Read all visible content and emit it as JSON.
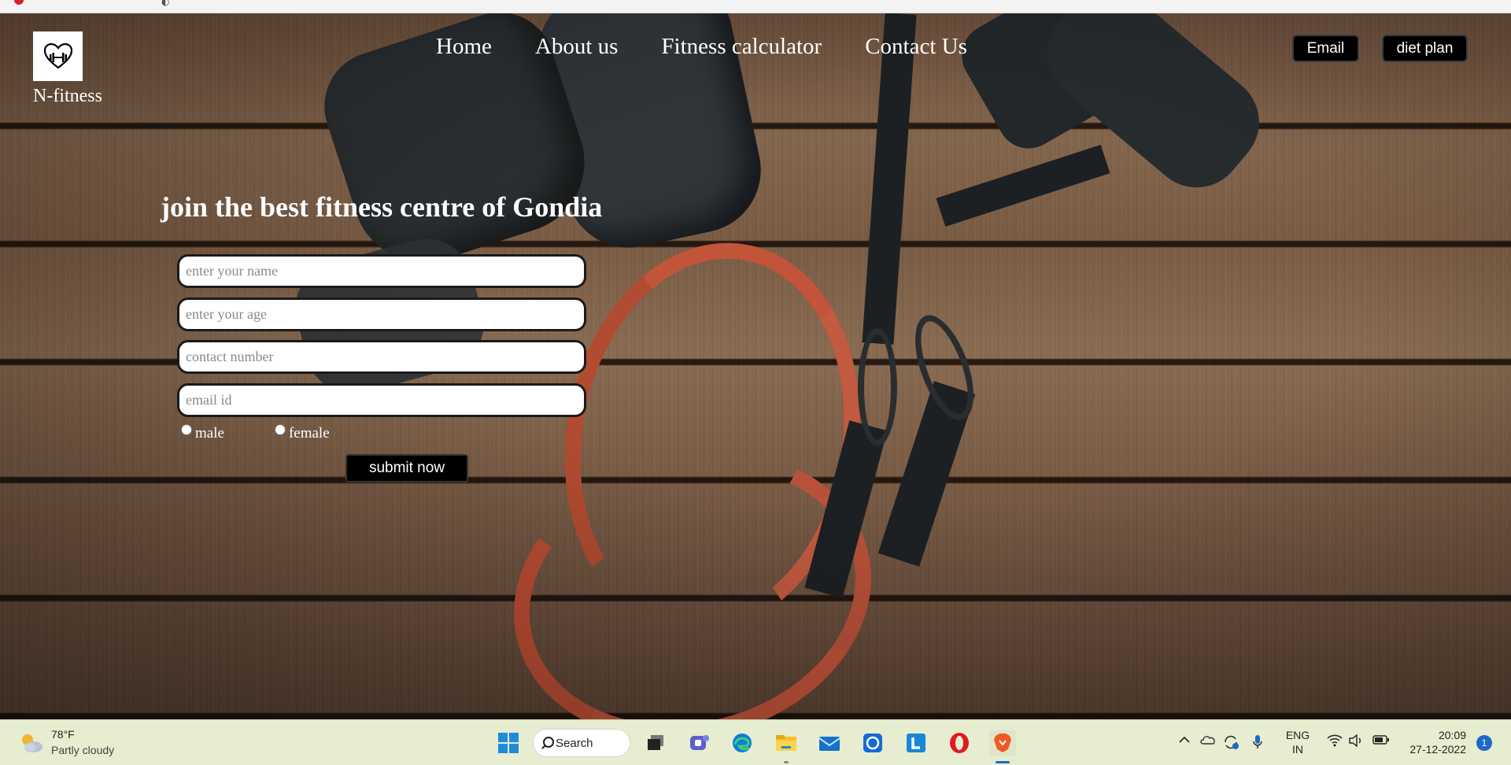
{
  "brand": {
    "name": "N-fitness"
  },
  "nav": {
    "items": [
      {
        "label": "Home"
      },
      {
        "label": "About us"
      },
      {
        "label": "Fitness calculator"
      },
      {
        "label": "Contact Us"
      }
    ]
  },
  "header_buttons": {
    "email": "Email",
    "diet_plan": "diet plan"
  },
  "hero": {
    "headline": "join the best fitness centre of Gondia"
  },
  "form": {
    "name_placeholder": "enter your name",
    "age_placeholder": "enter your age",
    "contact_placeholder": "contact number",
    "email_placeholder": "email id",
    "gender_options": [
      "male",
      "female"
    ],
    "submit_label": "submit now"
  },
  "taskbar": {
    "weather_temp": "78°F",
    "weather_desc": "Partly cloudy",
    "search_label": "Search",
    "apps": [
      "start-icon",
      "search-icon",
      "task-view-icon",
      "teams-icon",
      "edge-icon",
      "file-explorer-icon",
      "mail-icon",
      "app-blue-icon",
      "app-l-icon",
      "opera-icon",
      "brave-icon"
    ],
    "lang_line1": "ENG",
    "lang_line2": "IN",
    "time": "20:09",
    "date": "27-12-2022",
    "notification_count": "1"
  },
  "colors": {
    "button_bg": "#000000",
    "button_text": "#ffffff",
    "taskbar_bg": "#e6edd0",
    "accent": "#1b6ac9"
  }
}
